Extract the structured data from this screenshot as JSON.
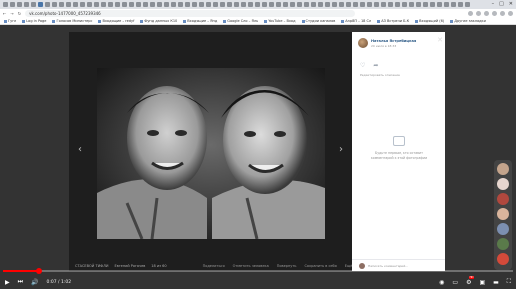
{
  "browser": {
    "url": "vk.com/photo-1477000_457239346",
    "bookmarks": [
      "Гугл",
      "Log in Page",
      "Голосов Министерс",
      "Входящие – redyf",
      "Фунд данных К10",
      "Входящие – Янд",
      "Google Сло – Яль",
      "YouTube – Вход",
      "Студии каналов",
      "Anp8П – 18 Сл",
      "АЗ Встречи Б.К",
      "Входящий (6)",
      "Другие закладки"
    ]
  },
  "post": {
    "author": "Наталья Ястребицкая",
    "date": "20 июля в 18:33",
    "edited": "Редактировать описание",
    "empty_text": "Будьте первым, кто оставит комментарий к этой фотографии",
    "comment_placeholder": "Написать комментарий..."
  },
  "viewer": {
    "caption_author": "СТАСЕВОЙ ТИФЛИ",
    "caption_name": "Евгений Рогачев",
    "caption_count": "18 из 60",
    "links": [
      "Поделиться",
      "Отметить человека",
      "Повернуть",
      "Сохранить в себя",
      "Ещё"
    ]
  },
  "player": {
    "time": "0:07 / 1:02",
    "progress": 0.07
  },
  "colors": {
    "vk_blue": "#2a5885",
    "progress_red": "#ff0000"
  }
}
